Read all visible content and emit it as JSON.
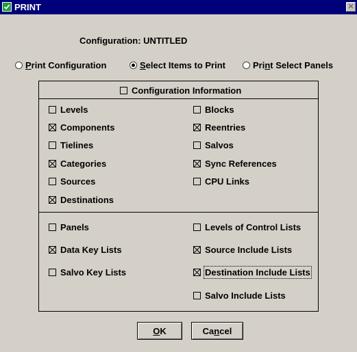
{
  "window": {
    "title": "PRINT",
    "close_glyph": "✕"
  },
  "configuration": {
    "label": "Configuration:",
    "value": "UNTITLED"
  },
  "modes": [
    {
      "pre": "",
      "accel": "P",
      "post": "rint Configuration",
      "selected": false
    },
    {
      "pre": "",
      "accel": "S",
      "post": "elect Items to Print",
      "selected": true
    },
    {
      "pre": "Pri",
      "accel": "n",
      "post": "t Select Panels",
      "selected": false
    }
  ],
  "group": {
    "header_label": "Configuration Information",
    "header_checked": false,
    "items_left": [
      {
        "label": "Levels",
        "checked": false
      },
      {
        "label": "Components",
        "checked": true
      },
      {
        "label": "Tielines",
        "checked": false
      },
      {
        "label": "Categories",
        "checked": true
      },
      {
        "label": "Sources",
        "checked": false
      },
      {
        "label": "Destinations",
        "checked": true
      }
    ],
    "items_right": [
      {
        "label": "Blocks",
        "checked": false
      },
      {
        "label": "Reentries",
        "checked": true
      },
      {
        "label": "Salvos",
        "checked": false
      },
      {
        "label": "Sync References",
        "checked": true
      },
      {
        "label": "CPU Links",
        "checked": false
      }
    ],
    "panel_items_left": [
      {
        "label": "Panels",
        "checked": false
      },
      {
        "label": "Data Key Lists",
        "checked": true
      },
      {
        "label": "Salvo Key Lists",
        "checked": false
      }
    ],
    "panel_items_right": [
      {
        "label": "Levels of Control Lists",
        "checked": false
      },
      {
        "label": "Source Include Lists",
        "checked": true
      },
      {
        "label": "Destination Include Lists",
        "checked": true,
        "focused": true
      },
      {
        "label": "Salvo Include Lists",
        "checked": false
      }
    ]
  },
  "buttons": {
    "ok": {
      "accel": "O",
      "post": "K"
    },
    "cancel": {
      "pre": "Ca",
      "accel": "n",
      "post": "cel"
    }
  },
  "colors": {
    "titlebar": "#00007b",
    "dialog_bg": "#d4d0c8",
    "app_icon": "#1e9e3c"
  },
  "icons": {
    "app": "app-check-icon",
    "close": "close-icon"
  }
}
